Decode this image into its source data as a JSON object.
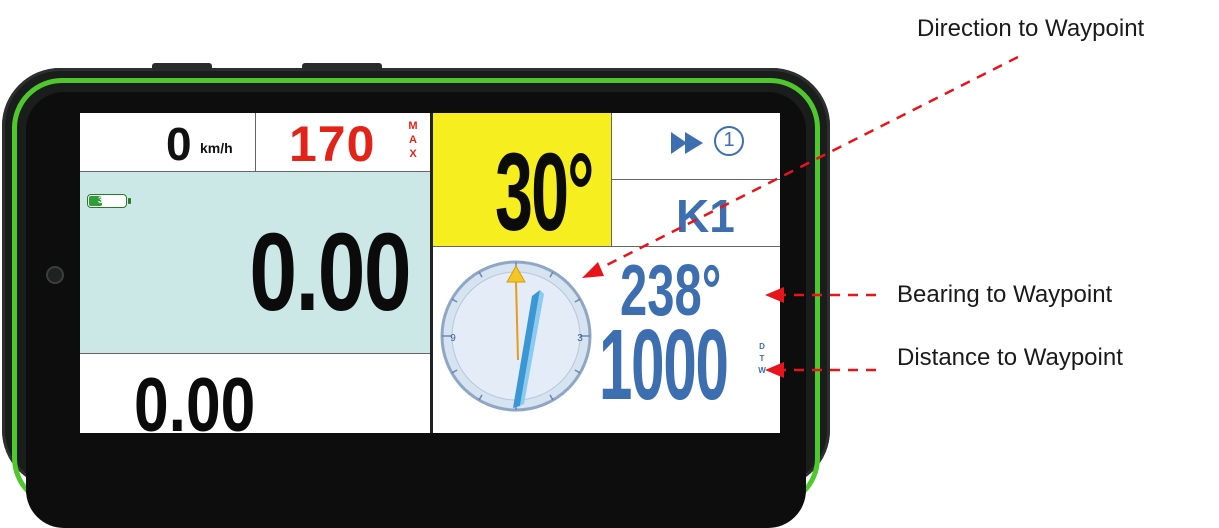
{
  "device": {
    "accent_color": "#4fc82e"
  },
  "dashboard": {
    "speed": {
      "value": "0",
      "unit": "km/h"
    },
    "max_speed": {
      "value": "170",
      "label_letters": [
        "M",
        "A",
        "X"
      ],
      "color": "#e2231a"
    },
    "battery": {
      "percent_label": "37%",
      "level": 37
    },
    "odometer": {
      "value": "0.00"
    },
    "partial": {
      "value": "0.00"
    },
    "heading": {
      "value": "30°",
      "background": "#f7ee1f"
    },
    "waypoint": {
      "nav_icon": "fast-forward-icon",
      "number": "1",
      "name": "K1",
      "color": "#3d6fb0"
    },
    "bearing": {
      "value": "238°"
    },
    "distance": {
      "value": "1000",
      "label_letters": [
        "D",
        "T",
        "W"
      ]
    },
    "compass": {
      "tick_labels": [
        "3",
        "9"
      ]
    }
  },
  "annotations": {
    "direction": "Direction to Waypoint",
    "bearing": "Bearing to Waypoint",
    "distance": "Distance to Waypoint",
    "color": "#e8141c"
  }
}
